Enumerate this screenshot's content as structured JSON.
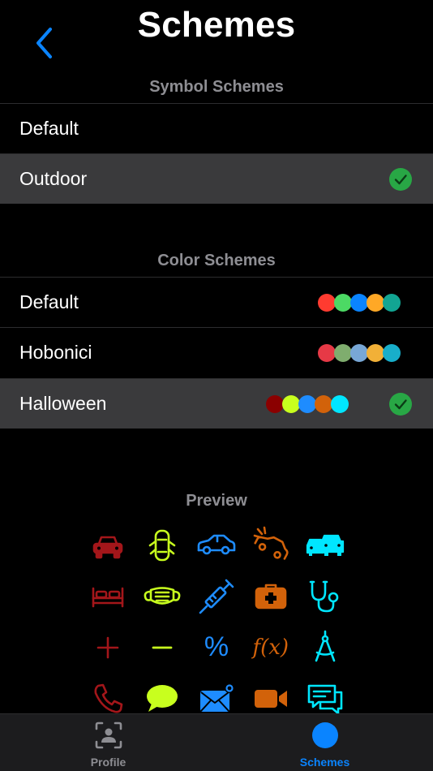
{
  "header": {
    "title": "Schemes",
    "back_icon": "chevron-left-icon"
  },
  "symbol_schemes": {
    "title": "Symbol Schemes",
    "items": [
      {
        "label": "Default",
        "selected": false
      },
      {
        "label": "Outdoor",
        "selected": true
      }
    ]
  },
  "color_schemes": {
    "title": "Color Schemes",
    "items": [
      {
        "label": "Default",
        "selected": false,
        "colors": [
          "#ff3b30",
          "#4cd964",
          "#0a84ff",
          "#ffa826",
          "#12a593"
        ]
      },
      {
        "label": "Hobonici",
        "selected": false,
        "colors": [
          "#e63946",
          "#7fad6e",
          "#78a7d6",
          "#f2b037",
          "#18aeca"
        ]
      },
      {
        "label": "Halloween",
        "selected": true,
        "colors": [
          "#8b0000",
          "#c8ff1e",
          "#1e8cff",
          "#d2620a",
          "#00e6ff"
        ]
      }
    ]
  },
  "preview": {
    "title": "Preview",
    "colors": [
      "#a3161a",
      "#c8ff1e",
      "#1e8cff",
      "#d2620a",
      "#00e6ff"
    ],
    "rows": [
      [
        "car-front-icon",
        "car-doors-open-icon",
        "car-side-icon",
        "car-crash-icon",
        "cars-icon"
      ],
      [
        "bed-icon",
        "face-mask-icon",
        "syringe-icon",
        "first-aid-kit-icon",
        "stethoscope-icon"
      ],
      [
        "plus-icon",
        "minus-icon",
        "percent-icon",
        "function-icon",
        "compass-drafting-icon"
      ],
      [
        "phone-icon",
        "speech-bubble-icon",
        "mail-badge-icon",
        "video-camera-icon",
        "chat-bubbles-icon"
      ]
    ],
    "texts": {
      "percent": "%",
      "function": "f(x)"
    }
  },
  "tabbar": {
    "tabs": [
      {
        "label": "Profile",
        "icon": "profile-scan-icon",
        "active": false,
        "color": "#8e8e93"
      },
      {
        "label": "Schemes",
        "icon": "circle-icon",
        "active": true,
        "color": "#0a84ff"
      }
    ]
  },
  "colors": {
    "accent": "#0a84ff",
    "check": "#28a745",
    "selected_row": "#3a3a3c",
    "secondary": "#8e8e93"
  }
}
